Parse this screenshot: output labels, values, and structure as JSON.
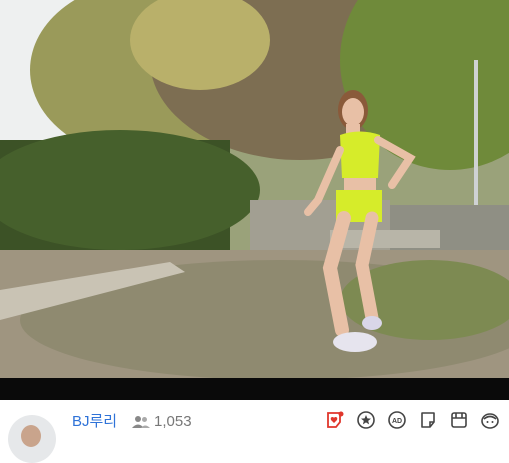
{
  "stream": {
    "streamer_name": "BJ루리",
    "viewer_count": "1,053"
  },
  "actions": [
    {
      "icon": "bookmark-heart-icon"
    },
    {
      "icon": "star-icon"
    },
    {
      "icon": "ad-icon"
    },
    {
      "icon": "share-icon"
    },
    {
      "icon": "gift-box-icon"
    },
    {
      "icon": "sticker-icon"
    },
    {
      "icon": "more-icon"
    }
  ],
  "colors": {
    "accent": "#2f73d8",
    "alert": "#e0362c",
    "outfit": "#d6ec2a"
  }
}
